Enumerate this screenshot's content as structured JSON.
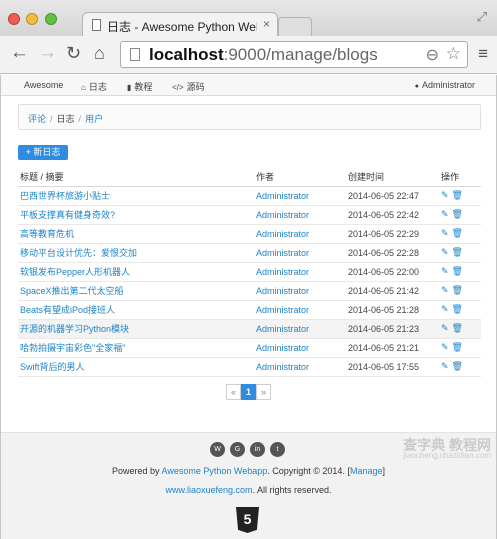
{
  "browser": {
    "tab_title": "日志 - Awesome Python Webapp",
    "tab_close": "×",
    "url_host": "localhost",
    "url_rest": ":9000/manage/blogs",
    "back_glyph": "←",
    "forward_glyph": "→",
    "reload_glyph": "↻",
    "home_glyph": "⌂",
    "zoom_glyph": "⊖",
    "star_glyph": "☆",
    "menu_glyph": "≡",
    "fullscreen_glyph": "⤢"
  },
  "navbar": {
    "brand": "Awesome",
    "items": [
      {
        "icon": "⌂",
        "label": "日志"
      },
      {
        "icon": "▮",
        "label": "教程"
      },
      {
        "icon": "</>",
        "label": "源码"
      }
    ],
    "user_icon": "●",
    "user": "Administrator"
  },
  "breadcrumb": {
    "items": [
      "评论",
      "日志",
      "用户"
    ],
    "separator": "/"
  },
  "new_button": "+ 新日志",
  "table": {
    "headers": [
      "标题 / 摘要",
      "作者",
      "创建时间",
      "操作"
    ],
    "rows": [
      {
        "title": "巴西世界杯旅游小贴士",
        "author": "Administrator",
        "date": "2014-06-05 22:47"
      },
      {
        "title": "平板支撑真有健身奇效?",
        "author": "Administrator",
        "date": "2014-06-05 22:42"
      },
      {
        "title": "高等教育危机",
        "author": "Administrator",
        "date": "2014-06-05 22:29"
      },
      {
        "title": "移动平台设计优先：爱恨交加",
        "author": "Administrator",
        "date": "2014-06-05 22:28"
      },
      {
        "title": "软银发布Pepper人形机器人",
        "author": "Administrator",
        "date": "2014-06-05 22:00"
      },
      {
        "title": "SpaceX推出第二代太空船",
        "author": "Administrator",
        "date": "2014-06-05 21:42"
      },
      {
        "title": "Beats有望成iPod接班人",
        "author": "Administrator",
        "date": "2014-06-05 21:28"
      },
      {
        "title": "开源的机器学习Python模块",
        "author": "Administrator",
        "date": "2014-06-05 21:23"
      },
      {
        "title": "哈勃拍摄宇宙彩色\"全家福\"",
        "author": "Administrator",
        "date": "2014-06-05 21:21"
      },
      {
        "title": "Swift背后的男人",
        "author": "Administrator",
        "date": "2014-06-05 17:55"
      }
    ],
    "edit_icon": "✎",
    "delete_icon": "🗑"
  },
  "pagination": {
    "prev": "«",
    "current": "1",
    "next": "»"
  },
  "footer": {
    "social_icons": [
      "weibo-icon",
      "github-icon",
      "linkedin-icon",
      "twitter-icon"
    ],
    "social_glyphs": [
      "W",
      "G",
      "in",
      "t"
    ],
    "powered_prefix": "Powered by ",
    "powered_link": "Awesome Python Webapp",
    "copyright": ". Copyright © 2014. [",
    "manage_link": "Manage",
    "close_bracket": "]",
    "site_link": "www.liaoxuefeng.com",
    "rights": ". All rights reserved.",
    "html5": "5"
  },
  "watermark": {
    "main": "查字典 教程网",
    "sub": "jiaocheng.chazidian.com"
  },
  "colors": {
    "link": "#1d84c7",
    "primary_button": "#2e8de0"
  }
}
